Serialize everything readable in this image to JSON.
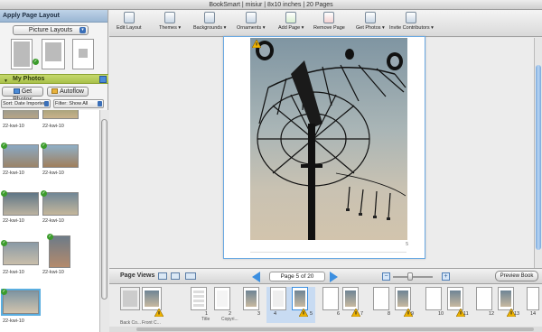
{
  "window": {
    "title": "BookSmart  |  misiur  |  8x10 inches  |  20 Pages"
  },
  "left_panel": {
    "layout_header": "Apply Page Layout",
    "layout_select": "Picture Layouts",
    "photos_header": "My Photos",
    "get_photos_label": "Get Photos",
    "autoflow_label": "Autoflow",
    "sort_label": "Sort: Date Imported",
    "filter_label": "Filter: Show All",
    "photos": [
      {
        "label": "22-kwi-10"
      },
      {
        "label": "22-kwi-10"
      },
      {
        "label": "22-kwi-10"
      },
      {
        "label": "22-kwi-10"
      },
      {
        "label": "22-kwi-10"
      },
      {
        "label": "22-kwi-10"
      },
      {
        "label": "22-kwi-10"
      },
      {
        "label": "22-kwi-10"
      },
      {
        "label": "22-kwi-10"
      },
      {
        "label": "22-kwi-10"
      },
      {
        "label": "22-kwi-10"
      }
    ]
  },
  "toolbar": {
    "items": [
      {
        "label": "Edit Layout",
        "icon": "edit-layout-icon"
      },
      {
        "label": "Themes ▾",
        "icon": "themes-icon"
      },
      {
        "label": "Backgrounds ▾",
        "icon": "backgrounds-icon"
      },
      {
        "label": "Ornaments ▾",
        "icon": "ornaments-icon"
      },
      {
        "label": "Add Page ▾",
        "icon": "add-page-icon"
      },
      {
        "label": "Remove Page",
        "icon": "remove-page-icon"
      },
      {
        "label": "Get Photos ▾",
        "icon": "get-photos-icon"
      },
      {
        "label": "Invite Contributors ▾",
        "icon": "invite-contributors-icon"
      }
    ]
  },
  "canvas": {
    "page_number": "5"
  },
  "page_views": {
    "label": "Page Views",
    "current_page": "Page 5 of 20",
    "preview_label": "Preview Book"
  },
  "filmstrip": {
    "back_cover": "Back Co...",
    "front_cover": "Front C...",
    "pages": [
      {
        "num": "1",
        "label": "Title"
      },
      {
        "num": "2",
        "label": "Copyri..."
      },
      {
        "num": "3",
        "label": ""
      },
      {
        "num": "4",
        "label": ""
      },
      {
        "num": "5",
        "label": ""
      },
      {
        "num": "6",
        "label": ""
      },
      {
        "num": "7",
        "label": ""
      },
      {
        "num": "8",
        "label": ""
      },
      {
        "num": "9",
        "label": ""
      },
      {
        "num": "10",
        "label": ""
      },
      {
        "num": "11",
        "label": ""
      },
      {
        "num": "12",
        "label": ""
      },
      {
        "num": "13",
        "label": ""
      },
      {
        "num": "14",
        "label": ""
      }
    ]
  },
  "colors": {
    "accent": "#3a6fb8",
    "selection": "#5aaee0",
    "photos_header": "#a9c14a",
    "warning": "#f0b400"
  }
}
